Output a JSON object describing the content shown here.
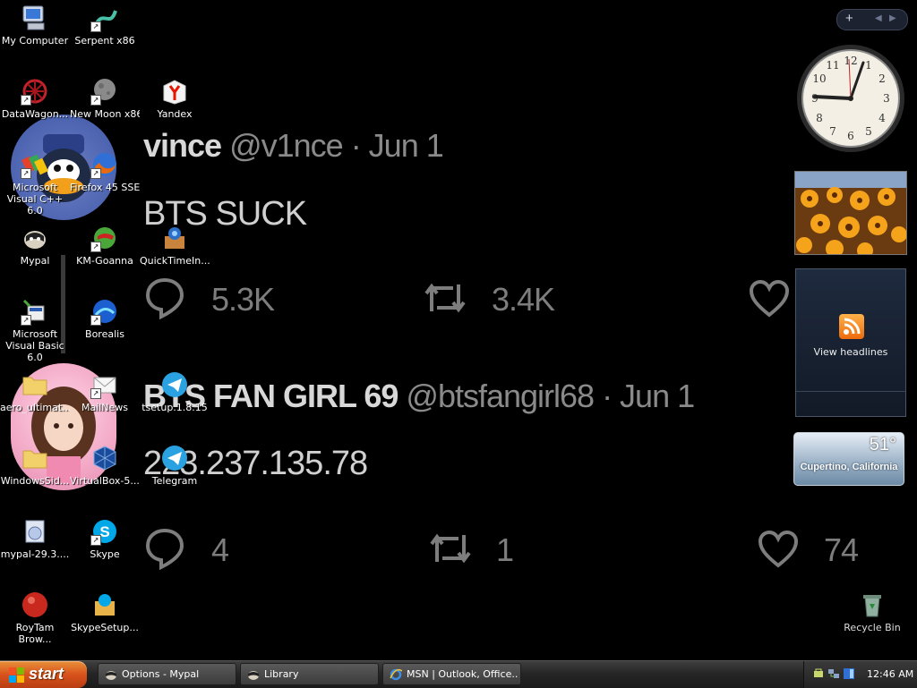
{
  "tweets": [
    {
      "name": "vince",
      "handle": "@v1nce · Jun 1",
      "text": "BTS SUCK",
      "replies": "5.3K",
      "retweets": "3.4K",
      "likes": ""
    },
    {
      "name": "BTS FAN GIRL 69",
      "handle": "@btsfangirl68 · Jun 1",
      "text": "223.237.135.78",
      "replies": "4",
      "retweets": "1",
      "likes": "74"
    }
  ],
  "desktop_icons": [
    {
      "label": "My Computer",
      "icon": "my-computer-icon"
    },
    {
      "label": "Serpent x86",
      "icon": "serpent-icon"
    },
    {
      "label": "DataWagon...",
      "icon": "datawagon-icon"
    },
    {
      "label": "New Moon x86",
      "icon": "new-moon-icon"
    },
    {
      "label": "Yandex",
      "icon": "yandex-icon"
    },
    {
      "label": "Microsoft Visual C++ 6.0",
      "icon": "visual-cpp-icon"
    },
    {
      "label": "Firefox 45 SSE",
      "icon": "firefox-icon"
    },
    {
      "label": "Mypal",
      "icon": "mypal-icon"
    },
    {
      "label": "KM-Goanna",
      "icon": "km-goanna-icon"
    },
    {
      "label": "QuickTimeIn...",
      "icon": "quicktime-installer-icon"
    },
    {
      "label": "Microsoft Visual Basic 6.0",
      "icon": "visual-basic-icon"
    },
    {
      "label": "Borealis",
      "icon": "borealis-icon"
    },
    {
      "label": "aero_ultimat...",
      "icon": "folder-icon"
    },
    {
      "label": "MailNews",
      "icon": "mailnews-icon"
    },
    {
      "label": "tsetup.1.8.15",
      "icon": "telegram-setup-icon"
    },
    {
      "label": "WindowsSid...",
      "icon": "folder-icon"
    },
    {
      "label": "VirtualBox-5....",
      "icon": "virtualbox-icon"
    },
    {
      "label": "Telegram",
      "icon": "telegram-icon"
    },
    {
      "label": "mypal-29.3....",
      "icon": "mypal-installer-icon"
    },
    {
      "label": "Skype",
      "icon": "skype-icon"
    },
    {
      "label": "RoyTam Brow...",
      "icon": "roytam-browser-icon"
    },
    {
      "label": "SkypeSetup...",
      "icon": "skype-setup-icon"
    },
    {
      "label": "Recycle Bin",
      "icon": "recycle-bin-icon"
    }
  ],
  "gadgets": {
    "clock": {
      "time_shown": "12:46"
    },
    "feed": {
      "caption": "View headlines"
    },
    "weather": {
      "temperature": "51°",
      "location": "Cupertino, California"
    }
  },
  "taskbar": {
    "start_label": "start",
    "buttons": [
      {
        "label": "Options - Mypal",
        "icon": "mypal-icon"
      },
      {
        "label": "Library",
        "icon": "library-icon"
      },
      {
        "label": "MSN | Outlook, Office...",
        "icon": "internet-explorer-icon"
      }
    ],
    "clock": "12:46 AM"
  },
  "colors": {
    "background": "#000000",
    "start_button": "#d8521c",
    "taskbar": "#262626",
    "tweet_text": "#d0d0d0",
    "tweet_muted": "#7d7d7d"
  }
}
